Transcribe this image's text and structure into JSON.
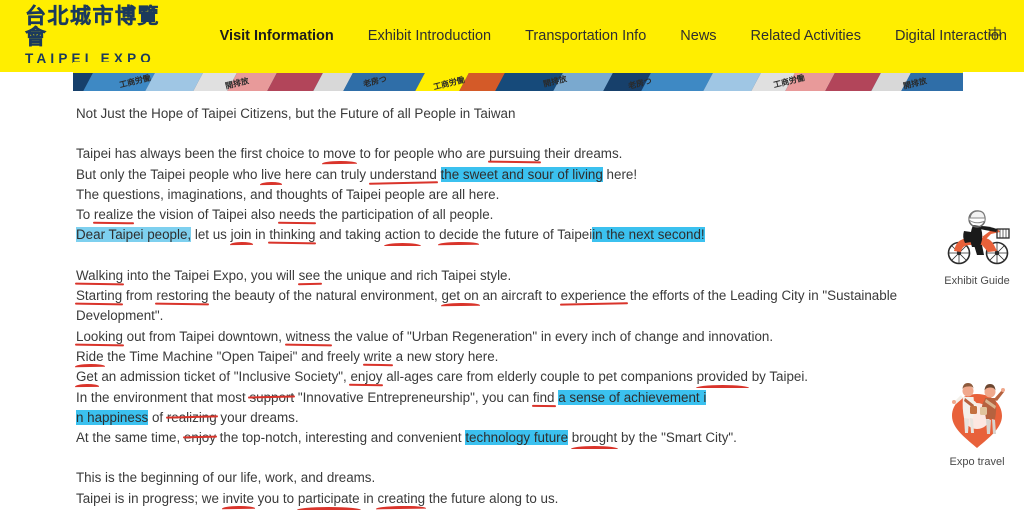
{
  "header": {
    "logo_cn": "台北城市博覽會",
    "logo_en": "TAIPEI EXPO",
    "lang_toggle": "中",
    "nav": [
      {
        "label": "Visit Information",
        "active": true
      },
      {
        "label": "Exhibit Introduction",
        "active": false
      },
      {
        "label": "Transportation Info",
        "active": false
      },
      {
        "label": "News",
        "active": false
      },
      {
        "label": "Related Activities",
        "active": false
      },
      {
        "label": "Digital Interaction",
        "active": false
      }
    ]
  },
  "banner": {
    "jp_texts": [
      "工商労働",
      "開排放",
      "老房つ",
      "工商労働",
      "開排放",
      "老房つ",
      "工商労働",
      "開排放"
    ],
    "colors": [
      "#17406b",
      "#3e89c4",
      "#9fc6e4",
      "#e0e0e0",
      "#e89a9a",
      "#b2455a",
      "#d8d8d8",
      "#2f6ea8",
      "#ffee00",
      "#d45a28",
      "#164a7a",
      "#7aa9cf"
    ]
  },
  "article": {
    "lead": "Not Just the Hope of Taipei Citizens, but the Future of all People in Taiwan",
    "p1": {
      "l1": {
        "a": "Taipei has always been the first choice to ",
        "m1": "move",
        "b": " to for people who are ",
        "m2": "pursuing",
        "c": " their dreams."
      },
      "l2": {
        "a": "But only the Taipei people who ",
        "m1": "live",
        "b": " here can truly ",
        "m2": "understand",
        "c": " ",
        "hl": "the sweet and sour of living",
        "d": " here!"
      },
      "l3": {
        "a": "The questions, imaginations, and thoughts of Taipei people are all here."
      },
      "l4": {
        "a": "To ",
        "m1": "realize",
        "b": " the vision of Taipei also ",
        "m2": "needs",
        "c": " the participation of all people."
      },
      "l5": {
        "hl1": "Dear Taipei people,",
        "a": " let us ",
        "m1": "join",
        "b": " in ",
        "m2": "thinking",
        "c": " and taking ",
        "m3": "action",
        "d": " to ",
        "m4": "decide",
        "e": " the future of Taipei",
        "hl2": "in the next second!"
      }
    },
    "p2": {
      "l1": {
        "m1": "Walking",
        "a": " into the Taipei Expo, you will ",
        "m2": "see",
        "b": " the unique and rich Taipei style."
      },
      "l2": {
        "m1": "Starting",
        "a": " from ",
        "m2": "restoring",
        "b": " the beauty of the natural environment, ",
        "m3": "get on",
        "c": " an aircraft to ",
        "m4": "experience",
        "d": " the efforts of the Leading City in \"Sustainable Development\"."
      },
      "l3": {
        "m1": "Looking",
        "a": " out from Taipei downtown, ",
        "m2": "witness",
        "b": " the value of \"Urban Regeneration\" in every inch of change and innovation."
      },
      "l4": {
        "m1": "Ride",
        "a": " the Time Machine \"Open Taipei\" and freely ",
        "m2": "write",
        "b": " a new story here."
      },
      "l5": {
        "m1": "Get",
        "a": " an admission ticket of \"Inclusive Society\", ",
        "m2": "enjoy",
        "b": " all-ages care from elderly couple to pet companions ",
        "m3": "provided",
        "c": " by Taipei."
      },
      "l6": {
        "a": "In the environment that most ",
        "m1": "support",
        "b": " \"Innovative Entrepreneurship\", you can ",
        "m2": "find",
        "c": " ",
        "hl": "a sense of achievement i"
      },
      "l7": {
        "hl": "n happiness",
        "a": " of ",
        "m1": "realizing",
        "b": " your dreams."
      },
      "l8": {
        "a": "At the same time, ",
        "m1": "enjoy",
        "b": " the top-notch, interesting and convenient ",
        "hl": "technology future",
        "c": " ",
        "m2": "brought",
        "d": " by the \"Smart City\"."
      }
    },
    "p3": {
      "l1": {
        "a": "This is the beginning of our life, work, and dreams."
      },
      "l2": {
        "a": "Taipei is in progress; we ",
        "m1": "invite",
        "b": " you to ",
        "m2": "participate",
        "c": " in ",
        "m3": "creating",
        "d": " the future along to us."
      }
    }
  },
  "side_widgets": [
    {
      "id": "exhibit-guide",
      "label": "Exhibit Guide",
      "icon": "scooter-rider-icon"
    },
    {
      "id": "expo-travel",
      "label": "Expo travel",
      "icon": "map-pin-travelers-icon"
    }
  ],
  "colors": {
    "brand_yellow": "#ffee00",
    "logo_navy": "#1b3a5c",
    "highlight_cyan": "#3bc1ef",
    "highlight_cyan_soft": "#7ed0ef",
    "annotation_red": "#d9342b",
    "accent_orange": "#e8613a",
    "body_text": "#3a3a3a"
  }
}
